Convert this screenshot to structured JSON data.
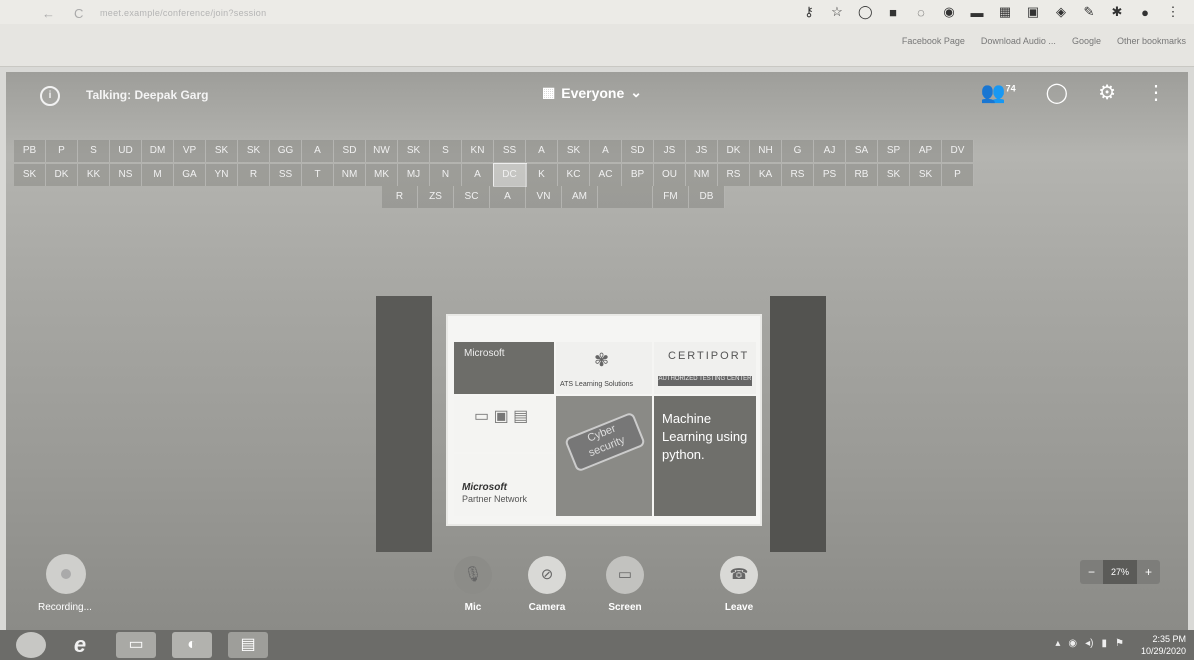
{
  "browser": {
    "back": "←",
    "reload": "C",
    "url": "meet.example/conference/join?session",
    "bookmarks": [
      "Facebook Page",
      "Download Audio ...",
      "Google",
      "Other bookmarks"
    ]
  },
  "meeting": {
    "talking": "Talking: Deepak Garg",
    "view": "Everyone",
    "participants_count": "74",
    "participants_row1": [
      "PB",
      "P",
      "S",
      "UD",
      "DM",
      "VP",
      "SK",
      "SK",
      "GG",
      "A",
      "SD",
      "NW",
      "SK",
      "S",
      "KN",
      "SS",
      "A",
      "SK",
      "A",
      "SD",
      "JS",
      "JS",
      "DK",
      "NH",
      "G",
      "AJ",
      "SA",
      "SP",
      "AP",
      "DV"
    ],
    "participants_row2": [
      "SK",
      "DK",
      "KK",
      "NS",
      "M",
      "GA",
      "YN",
      "R",
      "SS",
      "T",
      "NM",
      "MK",
      "MJ",
      "N",
      "A",
      "DC",
      "K",
      "KC",
      "AC",
      "BP",
      "OU",
      "NM",
      "RS",
      "KA",
      "RS",
      "PS",
      "RB",
      "SK",
      "SK",
      "P"
    ],
    "participants_row3": [
      "R",
      "ZS",
      "SC",
      "A",
      "VN",
      "AM",
      "",
      "FM",
      "DB"
    ],
    "slide": {
      "microsoft": "Microsoft",
      "ats": "ATS Learning Solutions",
      "certiport": "CERTIPORT",
      "certiport_sub": "AUTHORIZED TESTING CENTER",
      "cyber": "Cyber security",
      "ml": "Machine Learning using python.",
      "mpn_title": "Microsoft",
      "mpn_sub": "Partner Network"
    },
    "controls": {
      "mic": "Mic",
      "camera": "Camera",
      "screen": "Screen",
      "leave": "Leave",
      "recording": "Recording..."
    },
    "zoom": {
      "minus": "−",
      "value": "27%",
      "plus": "+"
    }
  },
  "taskbar": {
    "time": "2:35 PM",
    "date": "10/29/2020"
  }
}
